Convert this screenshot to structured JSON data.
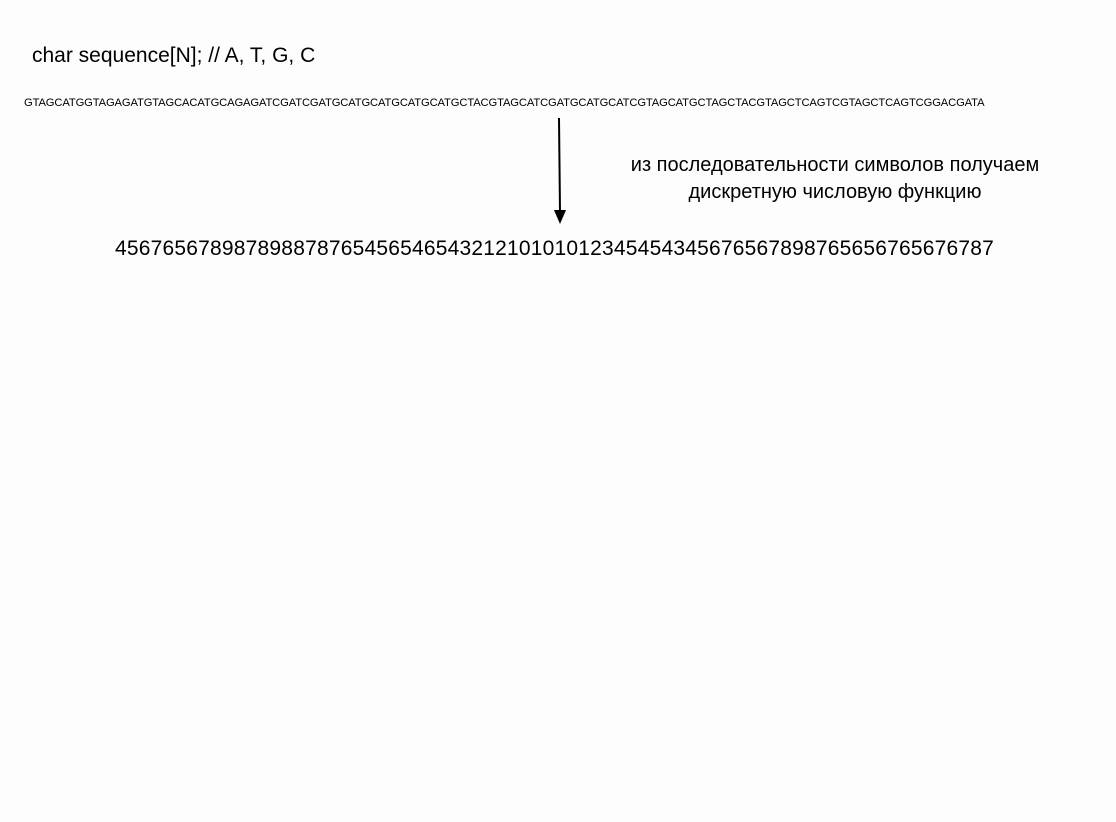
{
  "slide": {
    "declaration": "char sequence[N]; // A, T, G, C",
    "sequence": "GTAGCATGGTAGAGATGTAGCACATGCAGAGATCGATCGATGCATGCATGCATGCATGCTACGTAGCATCGATGCATGCATCGTAGCATGCTAGCTACGTAGCTCAGTCGTAGCTCAGTCGGACGATA",
    "caption": {
      "line1": "из последовательности символов получаем",
      "line2": "дискретную числовую функцию"
    },
    "numeric_function": "4567656789878988787654565465432121010101234545434567656789876565676567678​7"
  }
}
